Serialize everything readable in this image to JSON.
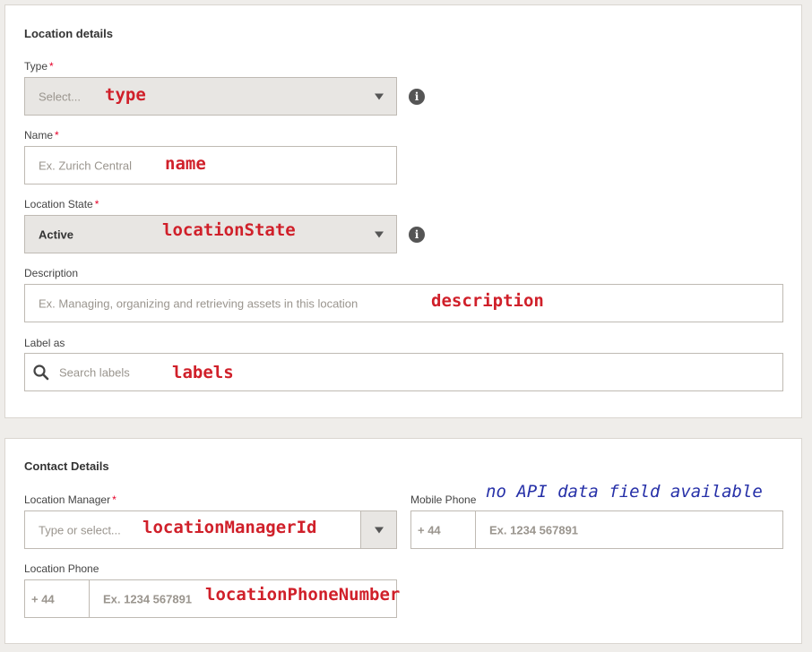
{
  "location_details": {
    "title": "Location details",
    "type": {
      "label": "Type",
      "required": "*",
      "placeholder": "Select...",
      "annotation": "type"
    },
    "name": {
      "label": "Name",
      "required": "*",
      "placeholder": "Ex. Zurich Central",
      "annotation": "name"
    },
    "location_state": {
      "label": "Location State",
      "required": "*",
      "value": "Active",
      "annotation": "locationState"
    },
    "description": {
      "label": "Description",
      "placeholder": "Ex. Managing, organizing and retrieving assets in this location",
      "annotation": "description"
    },
    "labels": {
      "label": "Label as",
      "placeholder": "Search labels",
      "annotation": "labels"
    },
    "info_glyph": "i"
  },
  "contact_details": {
    "title": "Contact Details",
    "location_manager": {
      "label": "Location Manager",
      "required": "*",
      "placeholder": "Type or select...",
      "annotation": "locationManagerId"
    },
    "mobile_phone": {
      "label": "Mobile Phone",
      "prefix": "+ 44",
      "placeholder": "Ex. 1234 567891",
      "note": "no API data field available"
    },
    "location_phone": {
      "label": "Location Phone",
      "prefix": "+ 44",
      "placeholder": "Ex. 1234 567891",
      "annotation": "locationPhoneNumber"
    }
  },
  "colors": {
    "required": "#e60028",
    "annotation": "#d0202a",
    "note": "#2630a8"
  }
}
